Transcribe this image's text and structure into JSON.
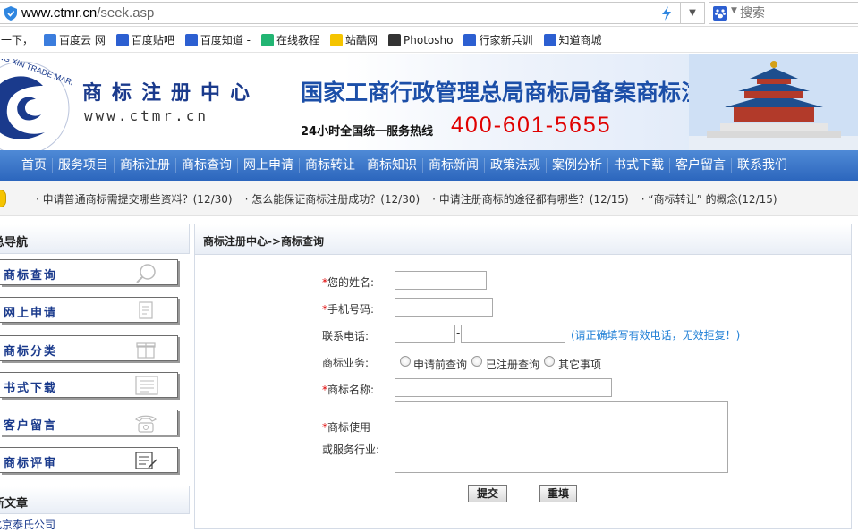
{
  "browser": {
    "url_domain": "www.ctmr.cn",
    "url_path": "/seek.asp",
    "search_placeholder": "搜索",
    "bookmarks": [
      {
        "label": "一下，",
        "icon": "none-icon",
        "color": "#ffffff"
      },
      {
        "label": "百度云 网",
        "icon": "cloud-icon",
        "color": "#3b7ddd"
      },
      {
        "label": "百度贴吧",
        "icon": "paw-icon",
        "color": "#2c5fd1"
      },
      {
        "label": "百度知道 -",
        "icon": "paw-icon",
        "color": "#2c5fd1"
      },
      {
        "label": "在线教程",
        "icon": "tutorial-icon",
        "color": "#22b573"
      },
      {
        "label": "站酷网",
        "icon": "zcool-icon",
        "color": "#f5c400"
      },
      {
        "label": "Photosho",
        "icon": "photoshop-icon",
        "color": "#333333"
      },
      {
        "label": "行家新兵训",
        "icon": "paw-icon",
        "color": "#2c5fd1"
      },
      {
        "label": "知道商城_",
        "icon": "paw-icon",
        "color": "#2c5fd1"
      }
    ]
  },
  "banner": {
    "site_name": "商标注册中心",
    "site_url": "www.ctmr.cn",
    "slogan": "国家工商行政管理总局商标局备案商标注册机构",
    "hotline_label": "24小时全国统一服务热线",
    "hotline_number": "400-601-5655"
  },
  "nav": [
    "首页",
    "服务项目",
    "商标注册",
    "商标查询",
    "网上申请",
    "商标转让",
    "商标知识",
    "商标新闻",
    "政策法规",
    "案例分析",
    "书式下载",
    "客户留言",
    "联系我们"
  ],
  "ticker": [
    "· 申请普通商标需提交哪些资料？(12/30)",
    "· 怎么能保证商标注册成功？(12/30)",
    "· 申请注册商标的途径都有哪些？(12/15)",
    "· “商标转让” 的概念(12/15)"
  ],
  "sidebar": {
    "header": "总导航",
    "items": [
      {
        "label": "商标查询",
        "icon": "magnifier-icon"
      },
      {
        "label": "网上申请",
        "icon": "document-icon"
      },
      {
        "label": "商标分类",
        "icon": "gift-icon"
      },
      {
        "label": "书式下载",
        "icon": "form-icon"
      },
      {
        "label": "客户留言",
        "icon": "telephone-icon"
      },
      {
        "label": "商标评审",
        "icon": "notepad-icon"
      }
    ],
    "news_header": "新文章",
    "news_first": "北京泰氏公司"
  },
  "main": {
    "breadcrumb": "商标注册中心->商标查询",
    "form": {
      "name_label": "您的姓名:",
      "mobile_label": "手机号码:",
      "phone_label": "联系电话:",
      "phone_sep": "-",
      "phone_hint": "(请正确填写有效电话，无效拒复！)",
      "business_label": "商标业务:",
      "options": [
        "申请前查询",
        "已注册查询",
        "其它事项"
      ],
      "tm_name_label": "商标名称:",
      "usage_label_1": "商标使用",
      "usage_label_2": "或服务行业:",
      "submit": "提交",
      "reset": "重填"
    }
  }
}
